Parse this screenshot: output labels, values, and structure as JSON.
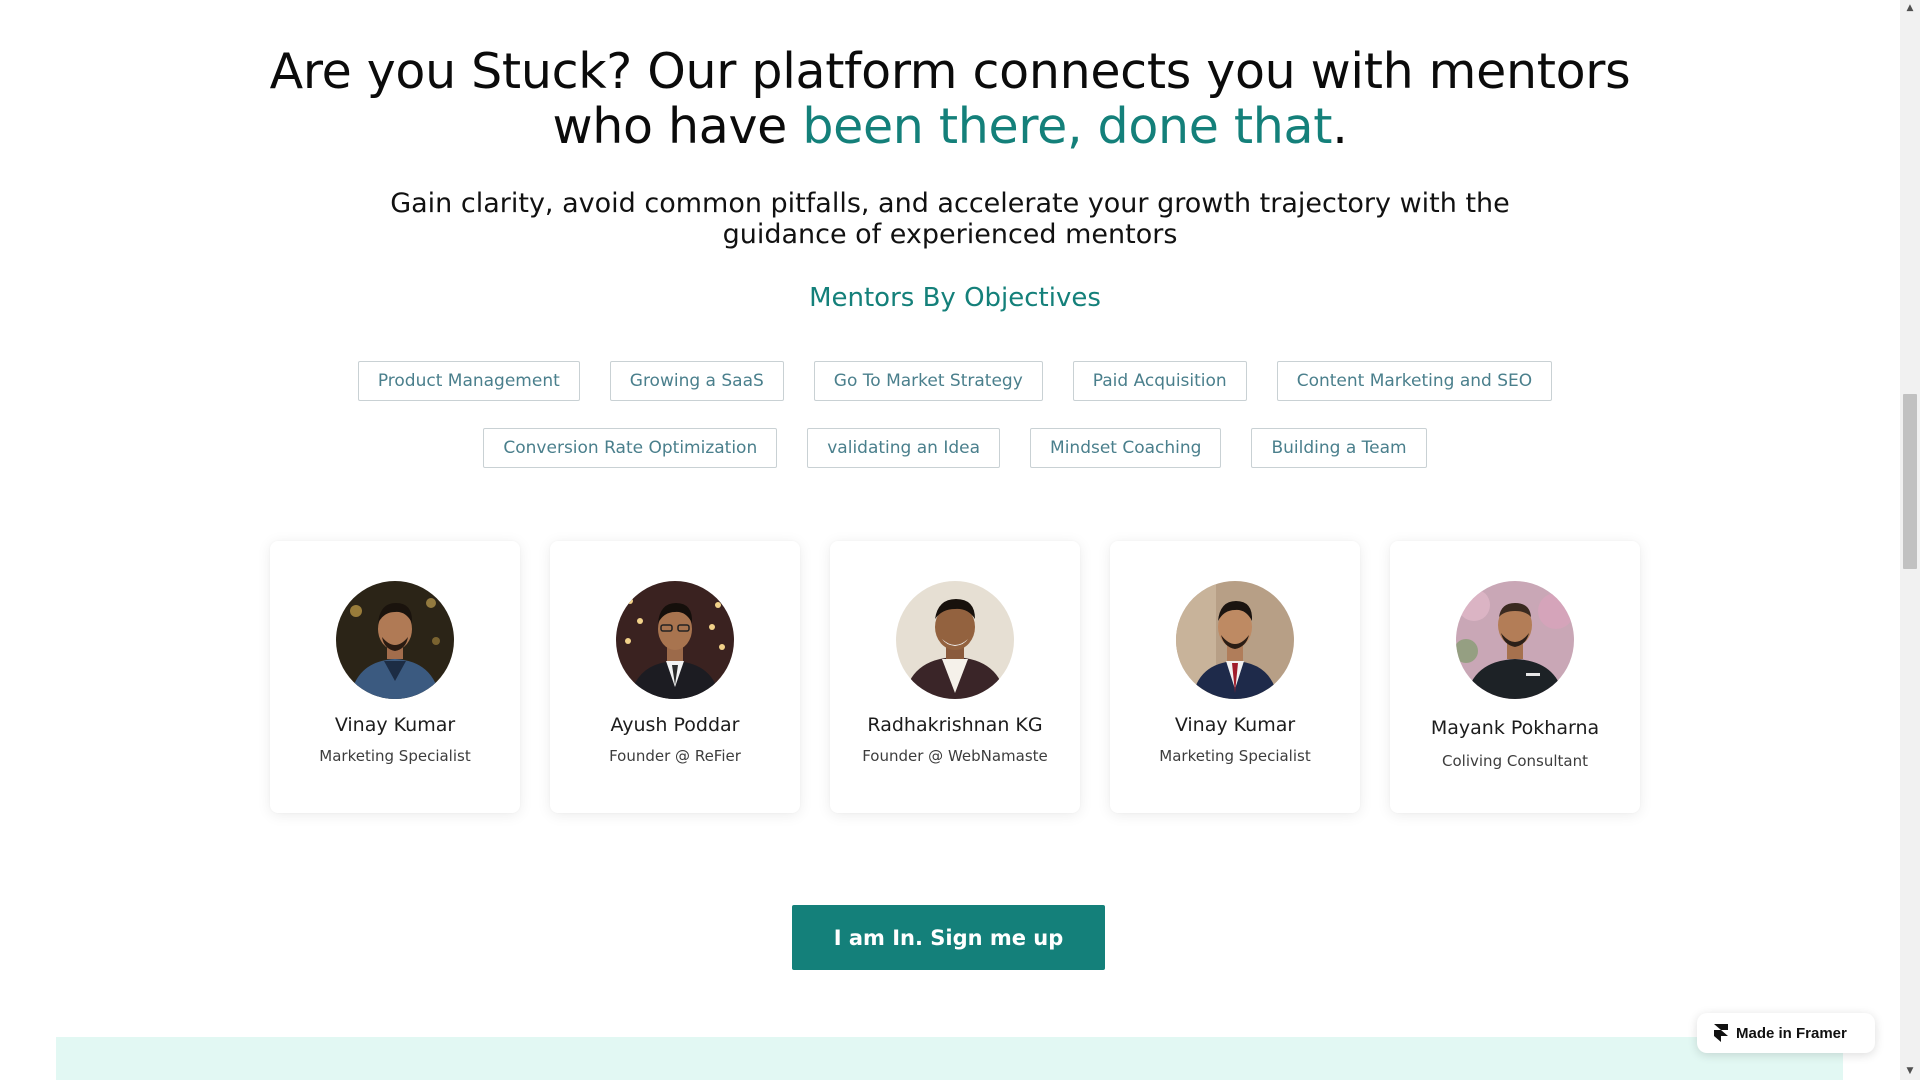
{
  "hero": {
    "title_part1": "Are you Stuck? Our platform connects you with mentors",
    "title_part2": "who have ",
    "title_accent": "been there, done that",
    "title_end": ".",
    "subtitle": "Gain clarity, avoid common pitfalls, and accelerate your growth trajectory with the guidance of experienced mentors"
  },
  "objectives": {
    "heading": "Mentors By Objectives",
    "row1": [
      "Product Management",
      "Growing a SaaS",
      "Go To Market Strategy",
      "Paid Acquisition",
      "Content Marketing and SEO"
    ],
    "row2": [
      "Conversion Rate Optimization",
      "validating an Idea",
      "Mindset Coaching",
      "Building a Team"
    ]
  },
  "mentors": [
    {
      "name": "Vinay Kumar",
      "role": "Marketing Specialist"
    },
    {
      "name": "Ayush Poddar",
      "role": "Founder @ ReFier"
    },
    {
      "name": "Radhakrishnan KG",
      "role": "Founder @ WebNamaste"
    },
    {
      "name": "Vinay Kumar",
      "role": "Marketing Specialist"
    },
    {
      "name": "Mayank Pokharna",
      "role": "Coliving Consultant"
    }
  ],
  "cta": {
    "label": "I am In. Sign me up"
  },
  "badge": {
    "label": "Made in Framer",
    "icon": "framer-logo-icon"
  },
  "colors": {
    "accent": "#14807a",
    "chip_text": "#4a7f8c",
    "band": "#e2f8f3"
  }
}
